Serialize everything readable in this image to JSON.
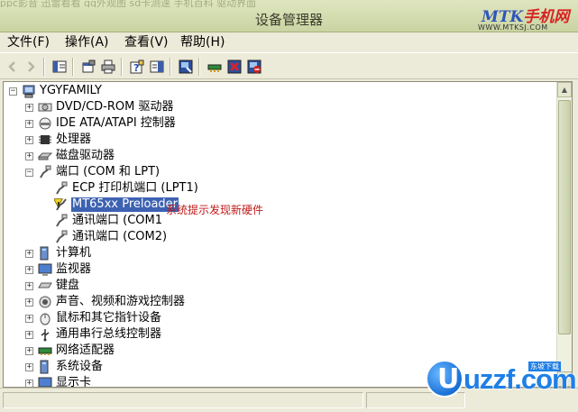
{
  "titlebar": {
    "bg_text": "ppc影音   迅雷看看   qq外观图   sd卡测速   手机百科   驱动界面",
    "title": "设备管理器",
    "watermark_logo_a": "MTK",
    "watermark_logo_b": "手机网",
    "watermark_url": "WWW.MTKSJ.COM"
  },
  "menu": {
    "file": "文件(F)",
    "action": "操作(A)",
    "view": "查看(V)",
    "help": "帮助(H)"
  },
  "toolbar": {
    "icons": [
      "back-icon",
      "forward-icon",
      "show-hide-tree-icon",
      "properties-icon",
      "print-icon",
      "help-icon",
      "details-icon",
      "scan-hardware-icon",
      "update-driver-icon",
      "uninstall-icon",
      "disable-icon"
    ]
  },
  "tree": {
    "root": "YGYFAMILY",
    "items": [
      {
        "label": "DVD/CD-ROM 驱动器"
      },
      {
        "label": "IDE ATA/ATAPI 控制器"
      },
      {
        "label": "处理器"
      },
      {
        "label": "磁盘驱动器"
      },
      {
        "label": "端口 (COM 和 LPT)"
      },
      {
        "label": "ECP 打印机端口 (LPT1)"
      },
      {
        "label": "MT65xx Preloader"
      },
      {
        "label": "通讯端口 (COM1"
      },
      {
        "label": "通讯端口 (COM2)"
      },
      {
        "label": "计算机"
      },
      {
        "label": "监视器"
      },
      {
        "label": "键盘"
      },
      {
        "label": "声音、视频和游戏控制器"
      },
      {
        "label": "鼠标和其它指针设备"
      },
      {
        "label": "通用串行总线控制器"
      },
      {
        "label": "网络适配器"
      },
      {
        "label": "系统设备"
      },
      {
        "label": "显示卡"
      }
    ]
  },
  "annotation": "系统提示发现新硬件",
  "watermark2": {
    "text": "uzzf.com",
    "tag": "东坡下载",
    "letter": "U"
  },
  "colors": {
    "selection": "#3d62b2",
    "annotation": "#c21919"
  }
}
